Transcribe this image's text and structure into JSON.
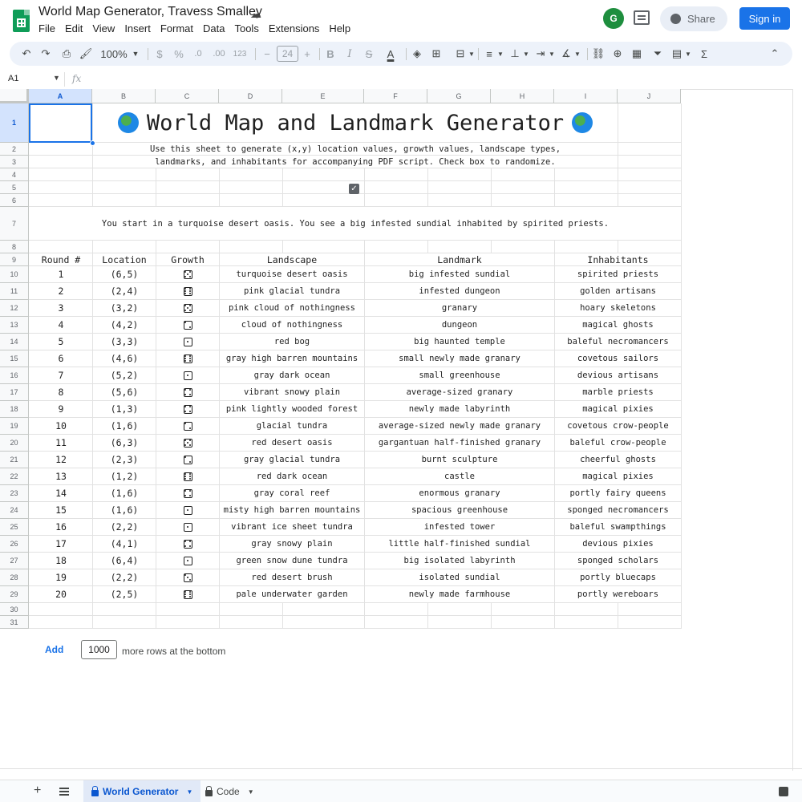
{
  "header": {
    "doc_title": "World Map Generator, Travess Smalley",
    "menu": [
      "File",
      "Edit",
      "View",
      "Insert",
      "Format",
      "Data",
      "Tools",
      "Extensions",
      "Help"
    ],
    "share_label": "Share",
    "signin_label": "Sign in"
  },
  "toolbar": {
    "zoom": "100%",
    "currency": "$",
    "percent": "%",
    "dec_decrease": ".0",
    "dec_increase": ".00",
    "number_format": "123",
    "font_size": "24",
    "bold": "B",
    "italic": "I",
    "strike": "S",
    "text_color": "A",
    "minus": "−",
    "plus": "+",
    "sum": "Σ"
  },
  "formula_bar": {
    "cell_ref": "A1",
    "fx": "fx"
  },
  "columns": [
    "A",
    "B",
    "C",
    "D",
    "E",
    "F",
    "G",
    "H",
    "I",
    "J"
  ],
  "rows": [
    "1",
    "2",
    "3",
    "4",
    "5",
    "6",
    "7",
    "8",
    "9",
    "10",
    "11",
    "12",
    "13",
    "14",
    "15",
    "16",
    "17",
    "18",
    "19",
    "20",
    "21",
    "22",
    "23",
    "24",
    "25",
    "26",
    "27",
    "28",
    "29",
    "30",
    "31"
  ],
  "sheet": {
    "title": "World Map and Landmark Generator",
    "intro_line1": "Use this sheet to generate (x,y) location values, growth values, landscape types,",
    "intro_line2": "landmarks, and inhabitants for accompanying PDF script. Check box to randomize.",
    "story": "You start in a turquoise desert oasis. You see a big infested sundial inhabited by spirited priests.",
    "headers": {
      "round": "Round #",
      "location": "Location",
      "growth": "Growth",
      "landscape": "Landscape",
      "landmark": "Landmark",
      "inhabitants": "Inhabitants"
    },
    "entries": [
      {
        "round": "1",
        "location": "(6,5)",
        "growth": 5,
        "landscape": "turquoise desert oasis",
        "landmark": "big infested sundial",
        "inhabitants": "spirited priests"
      },
      {
        "round": "2",
        "location": "(2,4)",
        "growth": 6,
        "landscape": "pink glacial tundra",
        "landmark": "infested dungeon",
        "inhabitants": "golden artisans"
      },
      {
        "round": "3",
        "location": "(3,2)",
        "growth": 5,
        "landscape": "pink cloud of nothingness",
        "landmark": "granary",
        "inhabitants": "hoary skeletons"
      },
      {
        "round": "4",
        "location": "(4,2)",
        "growth": 2,
        "landscape": "cloud of nothingness",
        "landmark": "dungeon",
        "inhabitants": "magical ghosts"
      },
      {
        "round": "5",
        "location": "(3,3)",
        "growth": 1,
        "landscape": "red bog",
        "landmark": "big haunted temple",
        "inhabitants": "baleful necromancers"
      },
      {
        "round": "6",
        "location": "(4,6)",
        "growth": 6,
        "landscape": "gray high barren mountains",
        "landmark": "small newly made granary",
        "inhabitants": "covetous sailors"
      },
      {
        "round": "7",
        "location": "(5,2)",
        "growth": 1,
        "landscape": "gray dark ocean",
        "landmark": "small  greenhouse",
        "inhabitants": "devious artisans"
      },
      {
        "round": "8",
        "location": "(5,6)",
        "growth": 4,
        "landscape": "vibrant snowy plain",
        "landmark": "average-sized  granary",
        "inhabitants": "marble priests"
      },
      {
        "round": "9",
        "location": "(1,3)",
        "growth": 4,
        "landscape": "pink lightly wooded forest",
        "landmark": "newly made labyrinth",
        "inhabitants": "magical pixies"
      },
      {
        "round": "10",
        "location": "(1,6)",
        "growth": 2,
        "landscape": "glacial tundra",
        "landmark": "average-sized newly made granary",
        "inhabitants": "covetous crow-people"
      },
      {
        "round": "11",
        "location": "(6,3)",
        "growth": 5,
        "landscape": "red desert oasis",
        "landmark": "gargantuan half-finished granary",
        "inhabitants": "baleful crow-people"
      },
      {
        "round": "12",
        "location": "(2,3)",
        "growth": 2,
        "landscape": "gray glacial tundra",
        "landmark": "burnt sculpture",
        "inhabitants": "cheerful ghosts"
      },
      {
        "round": "13",
        "location": "(1,2)",
        "growth": 6,
        "landscape": "red dark ocean",
        "landmark": "castle",
        "inhabitants": "magical pixies"
      },
      {
        "round": "14",
        "location": "(1,6)",
        "growth": 4,
        "landscape": "gray coral reef",
        "landmark": "enormous  granary",
        "inhabitants": "portly fairy queens"
      },
      {
        "round": "15",
        "location": "(1,6)",
        "growth": 1,
        "landscape": "misty high barren mountains",
        "landmark": "spacious  greenhouse",
        "inhabitants": "sponged necromancers"
      },
      {
        "round": "16",
        "location": "(2,2)",
        "growth": 1,
        "landscape": "vibrant ice sheet tundra",
        "landmark": "infested tower",
        "inhabitants": "baleful swampthings"
      },
      {
        "round": "17",
        "location": "(4,1)",
        "growth": 4,
        "landscape": "gray snowy plain",
        "landmark": "little half-finished sundial",
        "inhabitants": "devious pixies"
      },
      {
        "round": "18",
        "location": "(6,4)",
        "growth": 1,
        "landscape": "green snow dune tundra",
        "landmark": "big isolated labyrinth",
        "inhabitants": "sponged scholars"
      },
      {
        "round": "19",
        "location": "(2,2)",
        "growth": 3,
        "landscape": "red desert brush",
        "landmark": "isolated sundial",
        "inhabitants": "portly bluecaps"
      },
      {
        "round": "20",
        "location": "(2,5)",
        "growth": 6,
        "landscape": "pale underwater garden",
        "landmark": "newly made farmhouse",
        "inhabitants": "portly wereboars"
      }
    ]
  },
  "footer": {
    "add_label": "Add",
    "rows_value": "1000",
    "rows_suffix": "more rows at the bottom",
    "tabs": [
      "World Generator",
      "Code"
    ]
  },
  "colors": {
    "accent": "#1a73e8",
    "sheets_green": "#0f9d58",
    "toolbar_bg": "#edf2fa"
  }
}
